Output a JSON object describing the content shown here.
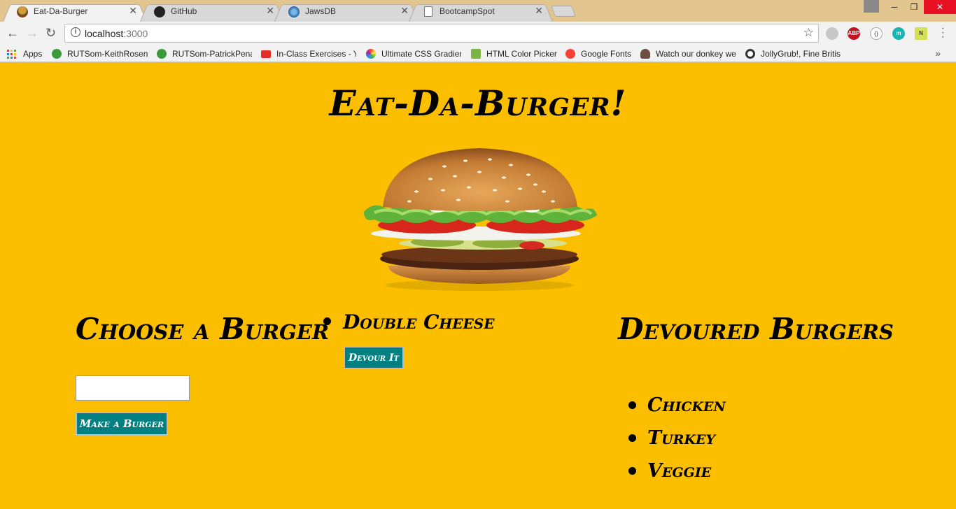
{
  "browser": {
    "tabs": [
      {
        "title": "Eat-Da-Burger",
        "active": true,
        "icon": "burger-favicon"
      },
      {
        "title": "GitHub",
        "active": false,
        "icon": "github-icon"
      },
      {
        "title": "JawsDB",
        "active": false,
        "icon": "jawsdb-icon"
      },
      {
        "title": "BootcampSpot",
        "active": false,
        "icon": "page-icon"
      }
    ],
    "url_host": "localhost",
    "url_port": ":3000",
    "bookmarks": [
      {
        "label": "Apps",
        "icon": "apps-grid-icon"
      },
      {
        "label": "RUTSom-KeithRosent",
        "icon": "recycle-icon",
        "color": "#3a9a3a"
      },
      {
        "label": "RUTSom-PatrickPena",
        "icon": "recycle-icon",
        "color": "#3a9a3a"
      },
      {
        "label": "In-Class Exercises - Yo",
        "icon": "youtube-icon",
        "color": "#e52d27"
      },
      {
        "label": "Ultimate CSS Gradien",
        "icon": "gradient-icon",
        "color": "#9c5cc9"
      },
      {
        "label": "HTML Color Picker",
        "icon": "color-picker-icon",
        "color": "#7cb342"
      },
      {
        "label": "Google Fonts",
        "icon": "google-fonts-icon",
        "color": "#f44336"
      },
      {
        "label": "Watch our donkey we",
        "icon": "heart-icon",
        "color": "#6d4c41"
      },
      {
        "label": "JollyGrub!, Fine Britis",
        "icon": "jollygrub-icon",
        "color": "#333333"
      }
    ]
  },
  "page": {
    "title": "Eat-Da-Burger!",
    "background": "#fbbf00",
    "accent": "#008080",
    "choose_heading": "Choose a Burger",
    "input_value": "",
    "make_button": "Make a Burger",
    "to_eat": [
      {
        "name": "Double Cheese",
        "button": "Devour It"
      }
    ],
    "devoured_heading": "Devoured Burgers",
    "devoured": [
      "Chicken",
      "Turkey",
      "Veggie"
    ]
  }
}
